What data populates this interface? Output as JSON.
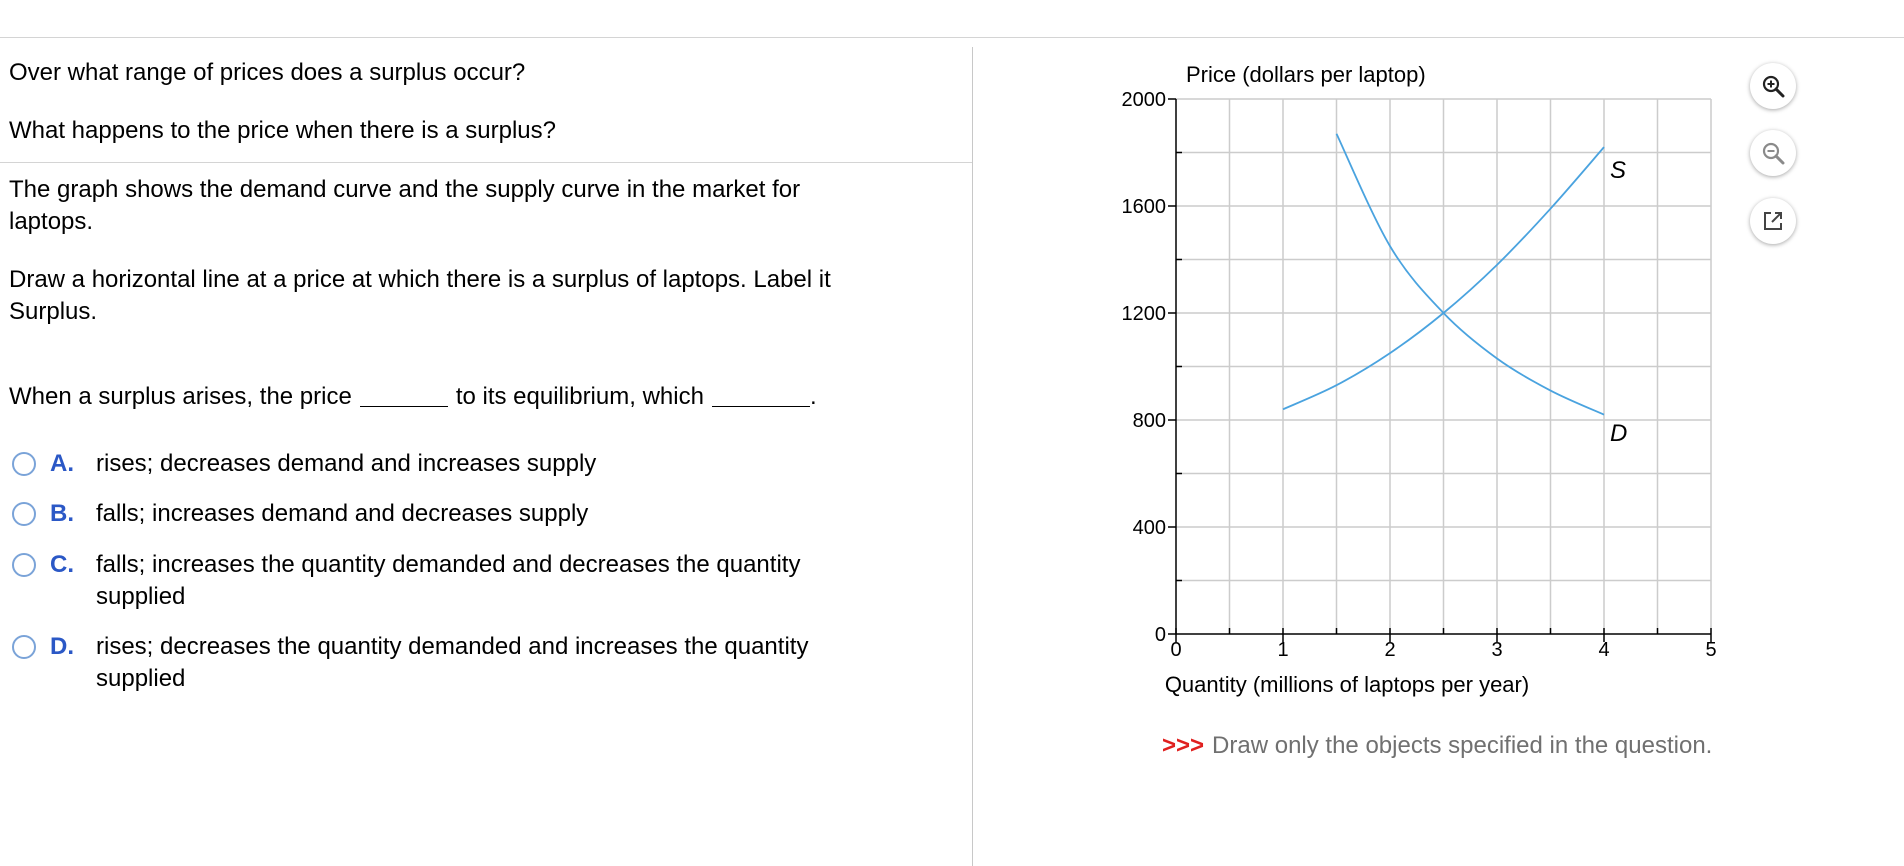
{
  "questions": {
    "q1": "Over what range of prices does a surplus occur?",
    "q2": "What happens to the price when there is a surplus?"
  },
  "description": "The graph shows the demand curve and the supply curve in the market for laptops.",
  "instruction": "Draw a horizontal line at a price at which there is a surplus of laptops. Label it Surplus.",
  "stem": {
    "part1": "When a surplus arises, the price",
    "part2": "to its equilibrium, which",
    "end": "."
  },
  "options": [
    {
      "letter": "A.",
      "text": "rises; decreases demand and increases supply"
    },
    {
      "letter": "B.",
      "text": "falls; increases demand and decreases supply"
    },
    {
      "letter": "C.",
      "text": "falls; increases the quantity demanded and decreases the quantity supplied"
    },
    {
      "letter": "D.",
      "text": "rises; decreases the quantity demanded and increases the quantity supplied"
    }
  ],
  "graph": {
    "ylabel": "Price (dollars per laptop)",
    "xlabel": "Quantity (millions of laptops per year)",
    "supply_label": "S",
    "demand_label": "D"
  },
  "chart_data": {
    "type": "line",
    "xlabel": "Quantity (millions of laptops per year)",
    "ylabel": "Price (dollars per laptop)",
    "xlim": [
      0,
      5
    ],
    "ylim": [
      0,
      2000
    ],
    "xticks": [
      0,
      1,
      2,
      3,
      4,
      5
    ],
    "yticks": [
      0,
      400,
      800,
      1200,
      1600,
      2000
    ],
    "grid": true,
    "series": [
      {
        "name": "S",
        "x": [
          1.0,
          1.5,
          2.0,
          2.5,
          3.0,
          3.5,
          4.0
        ],
        "y": [
          840,
          930,
          1050,
          1200,
          1380,
          1590,
          1820
        ]
      },
      {
        "name": "D",
        "x": [
          1.5,
          2.0,
          2.5,
          3.0,
          3.5,
          4.0
        ],
        "y": [
          1870,
          1450,
          1200,
          1030,
          910,
          820
        ]
      }
    ]
  },
  "note": {
    "arrows": ">>>",
    "text": "Draw only the objects specified in the question."
  },
  "colors": {
    "curve": "#4aa3df",
    "grid": "#cccccc",
    "option_letter": "#2b58c6",
    "radio": "#7aa3d8",
    "note_arrows": "#e0201f",
    "note_text": "#707070"
  },
  "icons": {
    "zoom_in": "magnifier-plus-icon",
    "zoom_out": "magnifier-minus-icon",
    "popout": "external-link-icon"
  }
}
